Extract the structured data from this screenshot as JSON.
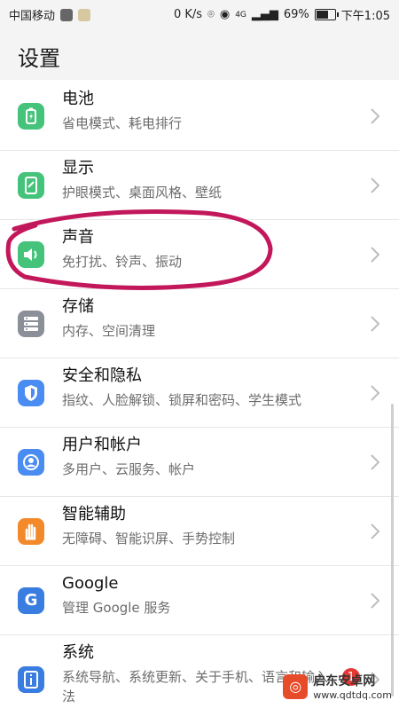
{
  "status_bar": {
    "carrier": "中国移动",
    "net_speed": "0 K/s",
    "network": "4G",
    "battery": "69%",
    "time": "下午1:05",
    "battery_level": 0.69
  },
  "header": {
    "title": "设置"
  },
  "items": [
    {
      "title": "电池",
      "subtitle": "省电模式、耗电排行",
      "icon": "battery-icon",
      "color": "#46c37b"
    },
    {
      "title": "显示",
      "subtitle": "护眼模式、桌面风格、壁纸",
      "icon": "display-icon",
      "color": "#46c37b"
    },
    {
      "title": "声音",
      "subtitle": "免打扰、铃声、振动",
      "icon": "sound-icon",
      "color": "#46c37b"
    },
    {
      "title": "存储",
      "subtitle": "内存、空间清理",
      "icon": "storage-icon",
      "color": "#8a8f98"
    },
    {
      "title": "安全和隐私",
      "subtitle": "指纹、人脸解锁、锁屏和密码、学生模式",
      "icon": "shield-icon",
      "color": "#4a8cf2"
    },
    {
      "title": "用户和帐户",
      "subtitle": "多用户、云服务、帐户",
      "icon": "user-icon",
      "color": "#4a8cf2"
    },
    {
      "title": "智能辅助",
      "subtitle": "无障碍、智能识屏、手势控制",
      "icon": "hand-icon",
      "color": "#f28a2b"
    },
    {
      "title": "Google",
      "subtitle": "管理 Google 服务",
      "icon": "google-icon",
      "color": "#3a7de0"
    },
    {
      "title": "系统",
      "subtitle": "系统导航、系统更新、关于手机、语言和输入法",
      "icon": "system-info-icon",
      "color": "#3a7de0",
      "badge": "1"
    }
  ],
  "annotation": {
    "color": "#c2185b"
  },
  "watermark": {
    "line1": "启东安卓网",
    "line2": "www.qdtdq.com"
  }
}
